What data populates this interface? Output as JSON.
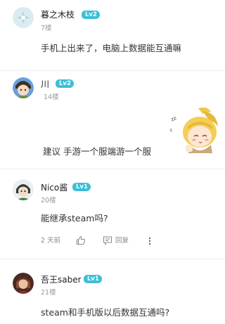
{
  "colors": {
    "accent": "#3cbfd6",
    "text_primary": "#222222",
    "text_secondary": "#999999"
  },
  "comments": [
    {
      "username": "暮之木枝",
      "level": "Lv2",
      "floor": "7楼",
      "content": "手机上出来了，电脑上数据能互通嘛"
    },
    {
      "username": "川",
      "level": "Lv2",
      "floor": "14楼",
      "content": "建议 手游一个服端游一个服",
      "sticker": "anime-girl-sticker"
    },
    {
      "username": "Nico酱",
      "level": "Lv1",
      "floor": "20楼",
      "content": "能继承steam吗?",
      "time": "2 天前",
      "reply_label": "回复"
    },
    {
      "username": "吾王saber",
      "level": "Lv1",
      "floor": "21楼",
      "content": "steam和手机版以后数据互通吗?"
    }
  ],
  "icons": {
    "like": "thumbs-up-icon",
    "reply": "comment-icon",
    "more": "more-vertical-icon"
  }
}
